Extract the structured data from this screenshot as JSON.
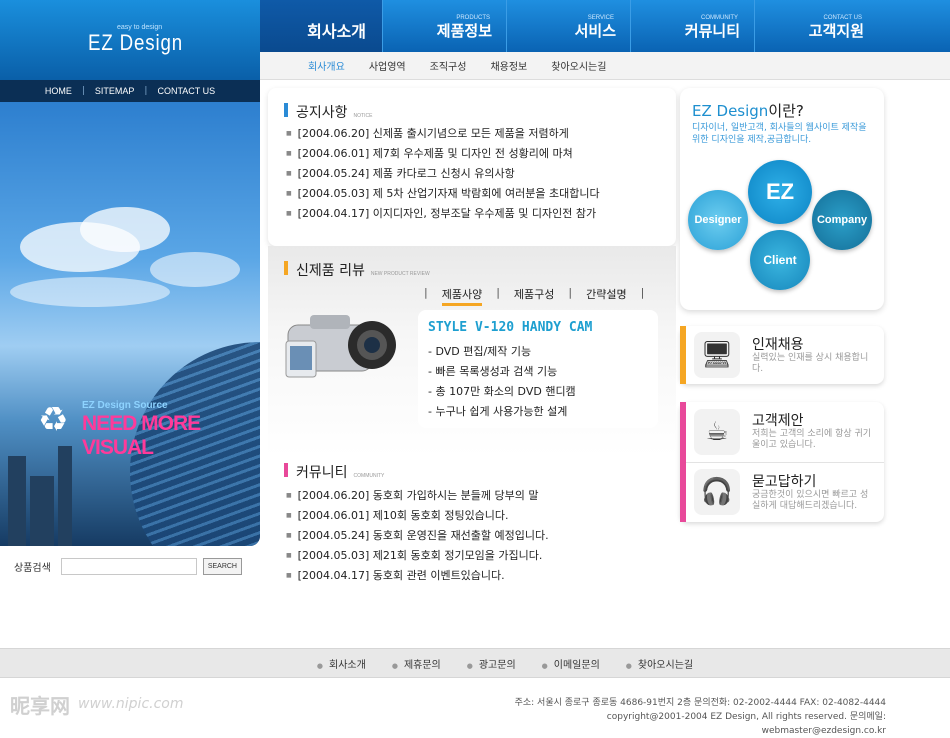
{
  "logo": {
    "small": "easy to design",
    "main": "EZ Design"
  },
  "topnav": {
    "items": [
      "HOME",
      "SITEMAP",
      "CONTACT US"
    ],
    "sep": "|"
  },
  "hero": {
    "source": "EZ Design Source",
    "title": "NEED MORE VISUAL",
    "recycle": "♻"
  },
  "search": {
    "label": "상품검색",
    "button": "SEARCH",
    "value": ""
  },
  "mainnav": [
    {
      "en": "",
      "ko": "회사소개"
    },
    {
      "en": "PRODUCTS",
      "ko": "제품정보"
    },
    {
      "en": "SERVICE",
      "ko": "서비스"
    },
    {
      "en": "COMMUNITY",
      "ko": "커뮤니티"
    },
    {
      "en": "CONTACT US",
      "ko": "고객지원"
    }
  ],
  "subnav": [
    "회사개요",
    "사업영역",
    "조직구성",
    "채용정보",
    "찾아오시는길"
  ],
  "notice": {
    "title": "공지사항",
    "en": "NOTICE",
    "items": [
      "[2004.06.20] 신제품 출시기념으로 모든 제품을 저렴하게",
      "[2004.06.01] 제7회 우수제품 및 디자인 전 성황리에 마쳐",
      "[2004.05.24] 제품 카다로그 신청시 유의사항",
      "[2004.05.03] 제 5차 산업기자재 박람회에 여러분을 초대합니다",
      "[2004.04.17] 이지디자인, 정부조달 우수제품 및 디자인전 참가"
    ]
  },
  "product": {
    "title": "신제품 리뷰",
    "en": "NEW PRODUCT REVIEW",
    "tabs": [
      "제품사양",
      "제품구성",
      "간략설명"
    ],
    "spec_title": "STYLE V-120 HANDY CAM",
    "spec": [
      "DVD 편집/제작 기능",
      "빠른 목록생성과 검색 기능",
      "총 107만 화소의 DVD 핸디캠",
      "누구나 쉽게 사용가능한 설계"
    ]
  },
  "community": {
    "title": "커뮤니티",
    "en": "COMMUNITY",
    "items": [
      "[2004.06.20] 동호회 가입하시는 분들께 당부의 말",
      "[2004.06.01] 제10회 동호회 정팅있습니다.",
      "[2004.05.24] 동호회 운영진을 재선출할 예정입니다.",
      "[2004.05.03] 제21회 동호회 정기모임을 가집니다.",
      "[2004.04.17] 동호회 관련 이벤트있습니다."
    ]
  },
  "about": {
    "title_en": "EZ Design",
    "title_ko": "이란?",
    "desc": "디자이너, 일반고객, 회사들의 웹사이트 제작을 위한 디자인을 제작,공급합니다.",
    "circles": {
      "center": "EZ",
      "left": "Designer",
      "right": "Company",
      "bottom": "Client"
    }
  },
  "cards": [
    {
      "title": "인재채용",
      "desc": "실력있는 인재를 상시 채용합니다.",
      "icon": "🖥"
    },
    {
      "title": "고객제안",
      "desc": "저희는 고객의 소리에 항상 귀기울이고 있습니다.",
      "icon": "☕"
    },
    {
      "title": "묻고답하기",
      "desc": "궁금한것이 있으시면 빠르고 성실하게 대답해드리겠습니다.",
      "icon": "🎧"
    }
  ],
  "footer": {
    "nav": [
      "회사소개",
      "제휴문의",
      "광고문의",
      "이메일문의",
      "찾아오시는길"
    ],
    "address": "주소: 서울시 종로구 종로동 4686-91번지 2층 문의전화: 02-2002-4444 FAX: 02-4082-4444",
    "copyright": "copyright@2001-2004 EZ Design, All rights reserved. 문의메일: webmaster@ezdesign.co.kr"
  },
  "watermark": {
    "cn": "昵享网",
    "url": "www.nipic.com"
  },
  "colors": {
    "blue": "#1a8fdd",
    "navy": "#0b2f55",
    "accent_blue": "#2a8bd6",
    "orange": "#f5a623",
    "pink": "#e8499a",
    "cyan": "#1e9fd0"
  }
}
